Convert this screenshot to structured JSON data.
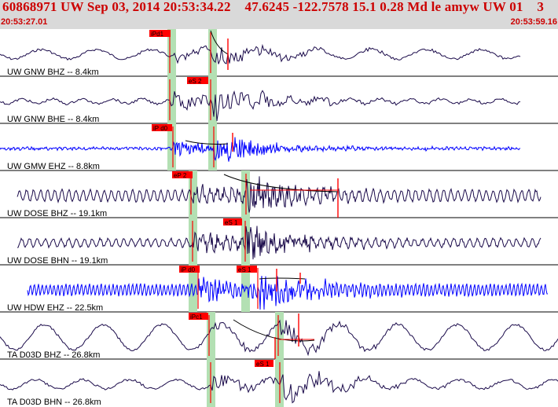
{
  "header": {
    "title": "60868971 UW Sep 03, 2014 20:53:34.22    47.6245 -122.7578 15.1 0.28 Md le amyw UW 01    3",
    "start_time": "20:53:27.01",
    "end_time": "20:53:59.16",
    "colors": {
      "title": "#cc0000",
      "band": "#d9d9d9"
    }
  },
  "traces": [
    {
      "label": "UW GNW BHZ -- 8.4km",
      "pick": "iPd1",
      "color": "#1a0a4a"
    },
    {
      "label": "UW GNW BHE -- 8.4km",
      "pick": "eS 2",
      "color": "#1a0a4a"
    },
    {
      "label": "UW GMW EHZ -- 8.8km",
      "pick": "iP d0",
      "color": "#0000ff"
    },
    {
      "label": "UW DOSE BHZ -- 19.1km",
      "pick": "eP 2",
      "color": "#1a0a4a"
    },
    {
      "label": "UW DOSE BHN -- 19.1km",
      "pick": "eS 1",
      "color": "#1a0a4a"
    },
    {
      "label": "UW HDW EHZ -- 22.5km",
      "pick": "iP d0",
      "pick2": "eS 1",
      "color": "#0000ff"
    },
    {
      "label": "TA D03D BHZ -- 26.8km",
      "pick": "iPc1",
      "color": "#1a0a4a"
    },
    {
      "label": "TA D03D BHN -- 26.8km",
      "pick": "eS 1",
      "color": "#1a0a4a"
    }
  ]
}
